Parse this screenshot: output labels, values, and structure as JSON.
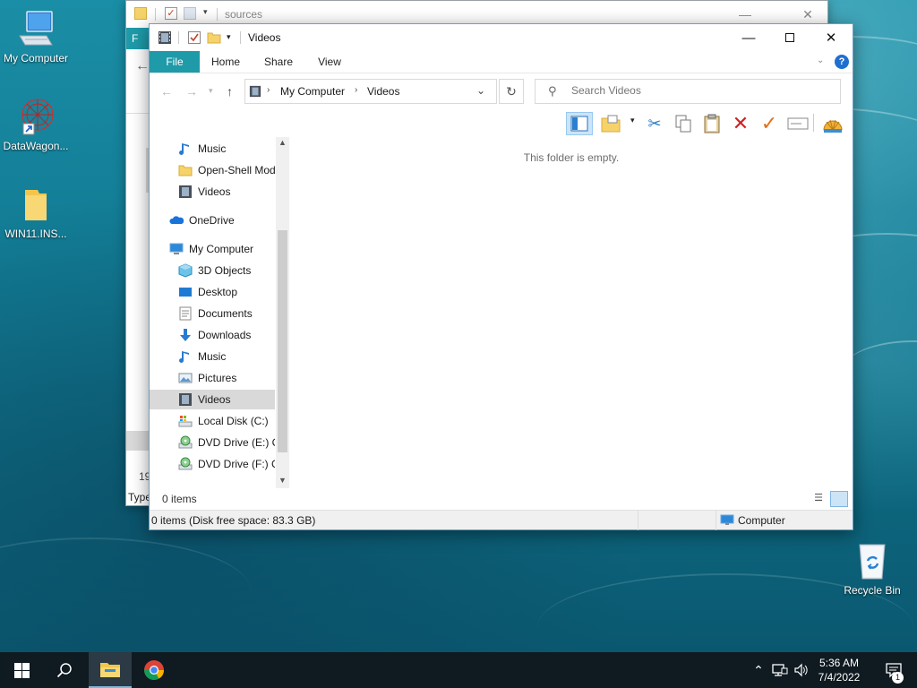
{
  "desktop": {
    "icons": [
      {
        "label": "My Computer"
      },
      {
        "label": "DataWagon..."
      },
      {
        "label": "WIN11.INS..."
      },
      {
        "label": "Recycle Bin"
      }
    ]
  },
  "back_window": {
    "title": "sources",
    "partial_tab": "F",
    "partial_status": "19",
    "partial_type": "Type"
  },
  "window": {
    "title": "Videos",
    "ribbon_tabs": [
      "File",
      "Home",
      "Share",
      "View"
    ],
    "breadcrumb": [
      "My Computer",
      "Videos"
    ],
    "search_placeholder": "Search Videos",
    "nav_items": [
      {
        "label": "Music",
        "icon": "music-icon"
      },
      {
        "label": "Open-Shell Mod",
        "icon": "folder-icon"
      },
      {
        "label": "Videos",
        "icon": "videos-icon"
      },
      {
        "label": "OneDrive",
        "icon": "onedrive-icon"
      },
      {
        "label": "My Computer",
        "icon": "computer-icon"
      },
      {
        "label": "3D Objects",
        "icon": "3d-objects-icon"
      },
      {
        "label": "Desktop",
        "icon": "desktop-icon"
      },
      {
        "label": "Documents",
        "icon": "documents-icon"
      },
      {
        "label": "Downloads",
        "icon": "downloads-icon"
      },
      {
        "label": "Music",
        "icon": "music-icon"
      },
      {
        "label": "Pictures",
        "icon": "pictures-icon"
      },
      {
        "label": "Videos",
        "icon": "videos-icon",
        "selected": true
      },
      {
        "label": "Local Disk (C:)",
        "icon": "local-disk-icon"
      },
      {
        "label": "DVD Drive (E:) CC",
        "icon": "dvd-drive-icon"
      },
      {
        "label": "DVD Drive (F:) CC",
        "icon": "dvd-drive-icon"
      }
    ],
    "empty_message": "This folder is empty.",
    "item_count": "0 items",
    "status_text": "0 items (Disk free space: 83.3 GB)",
    "status_location": "Computer"
  },
  "taskbar": {
    "time": "5:36 AM",
    "date": "7/4/2022",
    "notification_count": "1"
  }
}
